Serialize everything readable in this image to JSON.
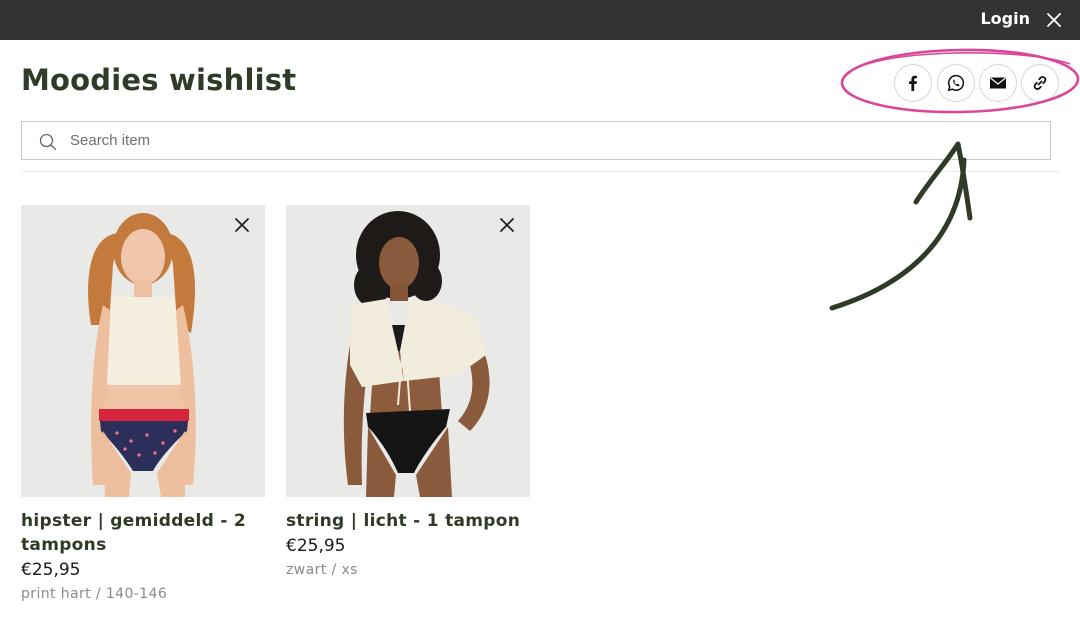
{
  "topbar": {
    "login_label": "Login"
  },
  "page": {
    "title": "Moodies wishlist"
  },
  "share": {
    "icons": [
      "facebook-icon",
      "whatsapp-icon",
      "email-icon",
      "link-icon"
    ]
  },
  "search": {
    "placeholder": "Search item"
  },
  "products": [
    {
      "name": "hipster | gemiddeld - 2 tampons",
      "price": "€25,95",
      "variant": "print hart / 140-146"
    },
    {
      "name": "string | licht - 1 tampon",
      "price": "€25,95",
      "variant": "zwart / xs"
    }
  ],
  "colors": {
    "topbar": "#333333",
    "title": "#2f3a27",
    "annotation_ellipse": "#d9479a",
    "annotation_arrow": "#2f3a27"
  }
}
